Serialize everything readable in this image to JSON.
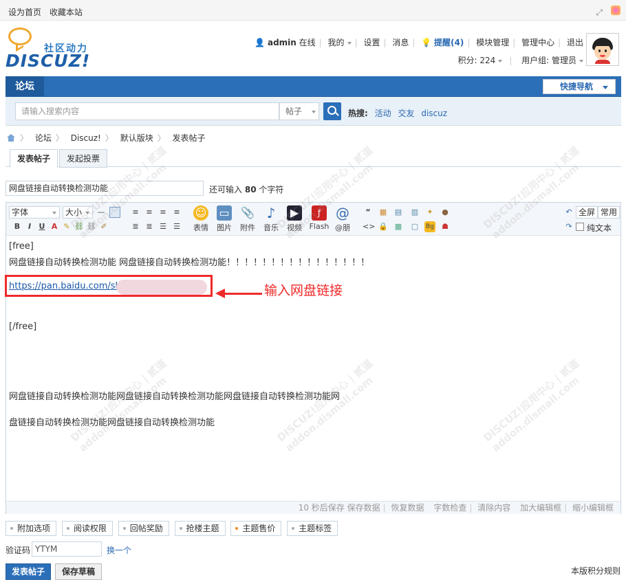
{
  "topbar": {
    "set_home": "设为首页",
    "bookmark": "收藏本站"
  },
  "logo": {
    "slogan": "社区动力",
    "word": "DISCUZ!"
  },
  "user": {
    "name": "admin",
    "status": "在线",
    "my": "我的",
    "settings": "设置",
    "messages": "消息",
    "remind": "提醒(4)",
    "module_mgmt": "模块管理",
    "admin_center": "管理中心",
    "logout": "退出",
    "points": "积分: 224",
    "group": "用户组: 管理员"
  },
  "nav": {
    "forum": "论坛",
    "quick_nav": "快捷导航"
  },
  "search": {
    "placeholder": "请输入搜索内容",
    "type": "帖子",
    "hot_label": "热搜:",
    "hot_words": [
      "活动",
      "交友",
      "discuz"
    ]
  },
  "breadcrumb": [
    "论坛",
    "Discuz!",
    "默认版块",
    "发表帖子"
  ],
  "post_tabs": [
    "发表帖子",
    "发起投票"
  ],
  "title_input": {
    "value": "网盘链接自动转换检测功能",
    "remaining_prefix": "还可输入",
    "remaining_count": "80",
    "remaining_suffix": "个字符"
  },
  "toolbar": {
    "font": "字体",
    "size": "大小",
    "big": [
      "表情",
      "图片",
      "附件",
      "音乐",
      "视频",
      "Flash",
      "@朋"
    ],
    "fullscreen": "全屏",
    "common": "常用",
    "plain_text": "纯文本"
  },
  "body": {
    "line1": "[free]",
    "line2": "网盘链接自动转换检测功能 网盘链接自动转换检测功能！！！！！！！！！！！！！！！！",
    "link": "https://pan.baidu.com/shar",
    "line4": "[/free]",
    "line5": "网盘链接自动转换检测功能网盘链接自动转换检测功能网盘链接自动转换检测功能网",
    "line6": "盘链接自动转换检测功能网盘链接自动转换检测功能",
    "annotation": "输入网盘链接"
  },
  "statusbar": {
    "autosave": "10 秒后保存",
    "save": "保存数据",
    "restore": "恢复数据",
    "check": "字数检查",
    "clear": "清除内容",
    "enlarge": "加大编辑框",
    "shrink": "缩小编辑框"
  },
  "options": [
    "附加选项",
    "阅读权限",
    "回帖奖励",
    "抢楼主题",
    "主题售价",
    "主题标签"
  ],
  "captcha": {
    "label": "验证码",
    "value": "YTYM",
    "change": "换一个"
  },
  "buttons": {
    "submit": "发表帖子",
    "draft": "保存草稿"
  },
  "rules": "本版积分规则",
  "watermark": {
    "a": "DISCUZ!应用中心 | 贰道",
    "b": "addon.dismall.com"
  }
}
